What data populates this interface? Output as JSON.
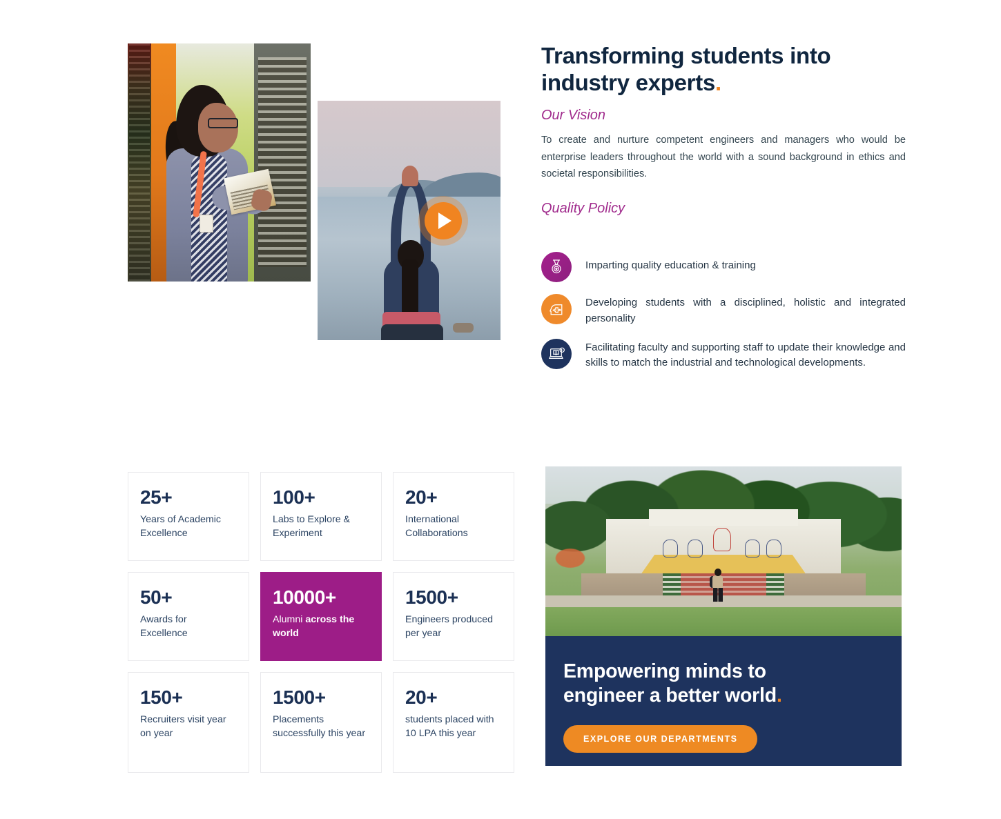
{
  "intro": {
    "heading_line1": "Transforming students into",
    "heading_line2": "industry experts",
    "heading_dot": ".",
    "vision_title": "Our Vision",
    "vision_text": "To create and nurture competent engineers and managers who would be enterprise leaders throughout the world with a sound background in ethics and societal responsibilities.",
    "quality_title": "Quality Policy"
  },
  "policies": [
    {
      "icon": "medal-icon",
      "color": "#a4218c",
      "text": "Imparting quality education & training"
    },
    {
      "icon": "head-puzzle-icon",
      "color": "#ef8a2b",
      "text": "Developing students with a disciplined, holistic and integrated personality"
    },
    {
      "icon": "laptop-elearning-icon",
      "color": "#1e335e",
      "text": "Facilitating faculty and supporting staff to update their knowledge and skills to match the industrial and technological developments."
    }
  ],
  "media": {
    "library_photo_alt": "Student reading a book in the library",
    "yoga_photo_alt": "Student doing yoga by the lake",
    "play_button": "play-icon"
  },
  "stats": [
    {
      "num": "25+",
      "label": "Years of Academic Excellence",
      "highlight": false
    },
    {
      "num": "100+",
      "label": "Labs to Explore & Experiment",
      "highlight": false
    },
    {
      "num": "20+",
      "label": "International Collaborations",
      "highlight": false
    },
    {
      "num": "50+",
      "label": "Awards for Excellence",
      "highlight": false
    },
    {
      "num": "10000+",
      "label": "Alumni across the world",
      "label_thin": "Alumni ",
      "label_bold": "across the world",
      "highlight": true
    },
    {
      "num": "1500+",
      "label": "Engineers produced per year",
      "highlight": false
    },
    {
      "num": "150+",
      "label": "Recruiters visit year on year",
      "highlight": false
    },
    {
      "num": "1500+",
      "label": "Placements successfully this year",
      "highlight": false
    },
    {
      "num": "20+",
      "label": "students placed with 10 LPA this year",
      "highlight": false
    }
  ],
  "panel": {
    "campus_photo_alt": "Campus amphitheatre with mural and student walking",
    "cta_line1": "Empowering minds to",
    "cta_line2": "engineer a better world",
    "cta_dot": ".",
    "cta_button": "EXPLORE OUR DEPARTMENTS"
  },
  "colors": {
    "navy": "#1e335e",
    "magenta": "#9d1d87",
    "orange": "#f08421",
    "heading_navy": "#10263f",
    "purple_heading": "#a02a8c"
  }
}
